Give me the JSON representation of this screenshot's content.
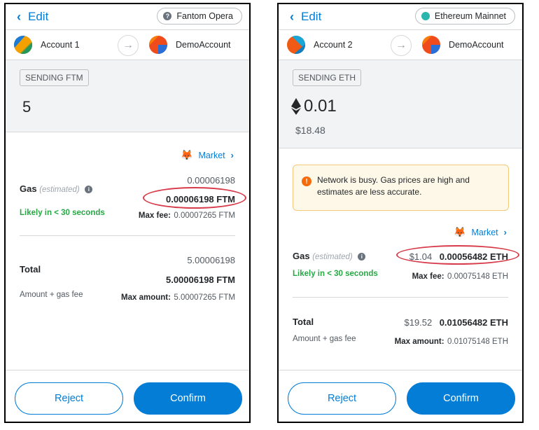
{
  "panels": [
    {
      "edit_label": "Edit",
      "network": "Fantom Opera",
      "from_account": "Account 1",
      "to_account": "DemoAccount",
      "sending_label": "SENDING FTM",
      "amount": "5",
      "market_label": "Market",
      "gas_label": "Gas",
      "gas_estimated": "(estimated)",
      "gas_grey": "0.00006198",
      "gas_bold": "0.00006198 FTM",
      "likely": "Likely in < 30 seconds",
      "max_fee_label": "Max fee:",
      "max_fee_value": "0.00007265 FTM",
      "total_label": "Total",
      "total_grey": "5.00006198",
      "total_bold": "5.00006198 FTM",
      "amount_gas_label": "Amount + gas fee",
      "max_amount_label": "Max amount:",
      "max_amount_value": "5.00007265 FTM",
      "reject": "Reject",
      "confirm": "Confirm"
    },
    {
      "edit_label": "Edit",
      "network": "Ethereum Mainnet",
      "from_account": "Account 2",
      "to_account": "DemoAccount",
      "sending_label": "SENDING ETH",
      "amount": "0.01",
      "fiat": "$18.48",
      "alert": "Network is busy. Gas prices are high and estimates are less accurate.",
      "market_label": "Market",
      "gas_label": "Gas",
      "gas_estimated": "(estimated)",
      "gas_fiat": "$1.04",
      "gas_bold": "0.00056482 ETH",
      "likely": "Likely in < 30 seconds",
      "max_fee_label": "Max fee:",
      "max_fee_value": "0.00075148 ETH",
      "total_label": "Total",
      "total_fiat": "$19.52",
      "total_bold": "0.01056482 ETH",
      "amount_gas_label": "Amount + gas fee",
      "max_amount_label": "Max amount:",
      "max_amount_value": "0.01075148 ETH",
      "reject": "Reject",
      "confirm": "Confirm"
    }
  ],
  "colors": {
    "accent": "#037dd6",
    "success": "#28a745",
    "highlight_ring": "#d73a49",
    "warning": "#f66a0a"
  },
  "icons": [
    "chevron-left-icon",
    "help-icon",
    "network-dot-icon",
    "arrow-right-icon",
    "metamask-fox-icon",
    "chevron-right-icon",
    "info-icon",
    "ethereum-icon",
    "warning-icon"
  ]
}
